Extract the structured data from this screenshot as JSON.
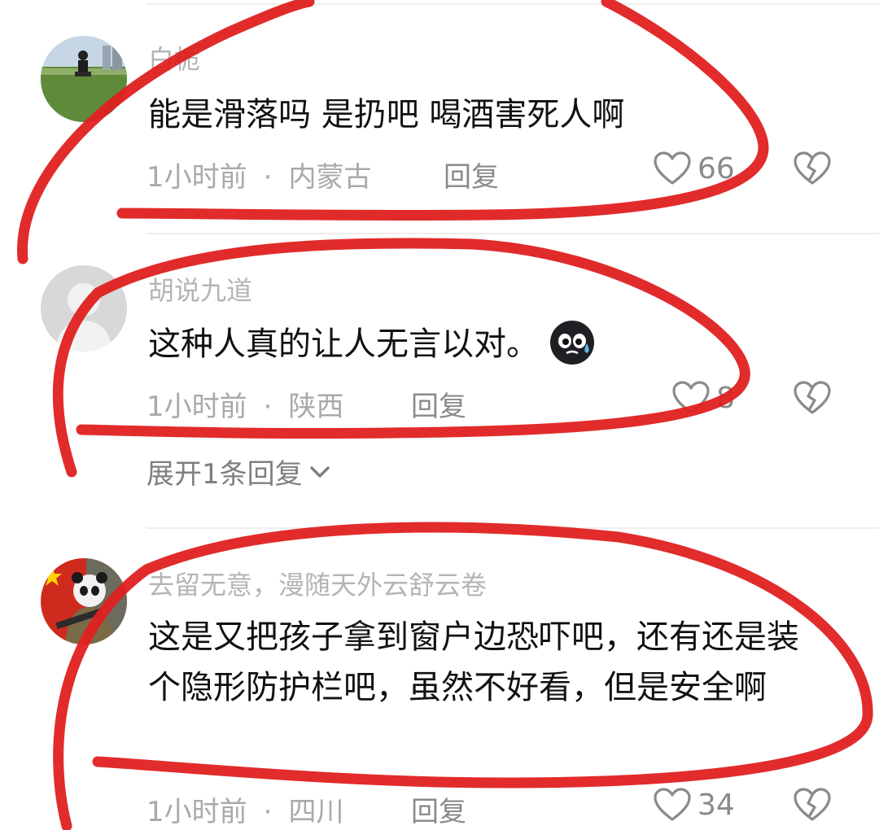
{
  "colors": {
    "username": "#b4b4b4",
    "body_text": "#111111",
    "meta": "#a9a9a9",
    "annotation_stroke": "#e02020"
  },
  "comments": [
    {
      "username": "白栀",
      "text": "能是滑落吗 是扔吧 喝酒害死人啊",
      "time": "1小时前",
      "location": "内蒙古",
      "reply_label": "回复",
      "likes": "66",
      "avatar": "photo-avatar-field"
    },
    {
      "username": "胡说九道",
      "text": "这种人真的让人无言以对。",
      "emoji": "sweat-face-emoji",
      "time": "1小时前",
      "location": "陕西",
      "reply_label": "回复",
      "likes": "8",
      "avatar": "default-gray-avatar",
      "expand_label": "展开1条回复"
    },
    {
      "username": "去留无意，漫随天外云舒云卷",
      "text": "这是又把孩子拿到窗户边恐吓吧，还有还是装个隐形防护栏吧，虽然不好看，但是安全啊",
      "time": "1小时前",
      "location": "四川",
      "reply_label": "回复",
      "likes": "34",
      "avatar": "photo-avatar-panda-soldier"
    }
  ],
  "separator": "·"
}
